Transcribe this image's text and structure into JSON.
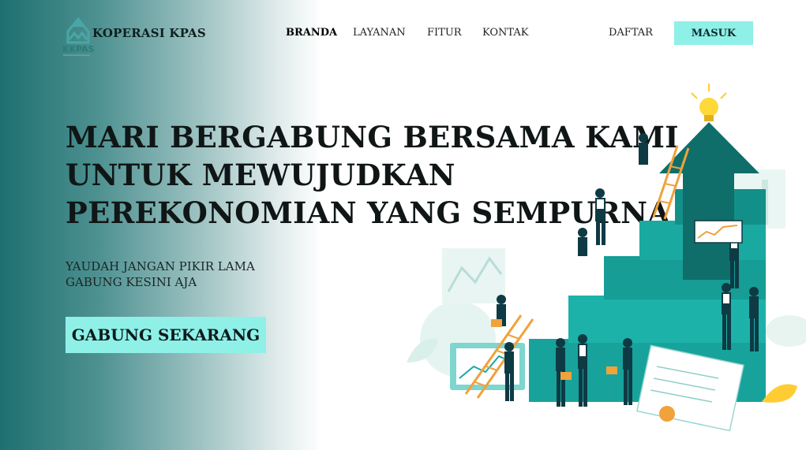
{
  "brand": {
    "name": "KOPERASI KPAS",
    "logo_text": "KKPAS"
  },
  "nav": {
    "items": [
      {
        "label": "BRANDA",
        "active": true
      },
      {
        "label": "LAYANAN",
        "active": false
      },
      {
        "label": "FITUR",
        "active": false
      },
      {
        "label": "KONTAK",
        "active": false
      }
    ],
    "daftar_label": "DAFTAR",
    "masuk_label": "MASUK"
  },
  "hero": {
    "headline_lines": [
      "MARI BERGABUNG  BERSAMA KAMI",
      "UNTUK MEWUJUDKAN",
      "PEREKONOMIAN YANG SEMPURNA"
    ],
    "subtitle_lines": [
      "YAUDAH JANGAN PIKIR LAMA",
      "GABUNG KESINI AJA"
    ],
    "cta_label": "GABUNG SEKARANG",
    "illustration_icon": "growth-teamwork-illustration"
  },
  "colors": {
    "accent": "#8ff0e8",
    "gradient_start": "#1e7070",
    "illustration_teal": "#1aa5a0"
  }
}
